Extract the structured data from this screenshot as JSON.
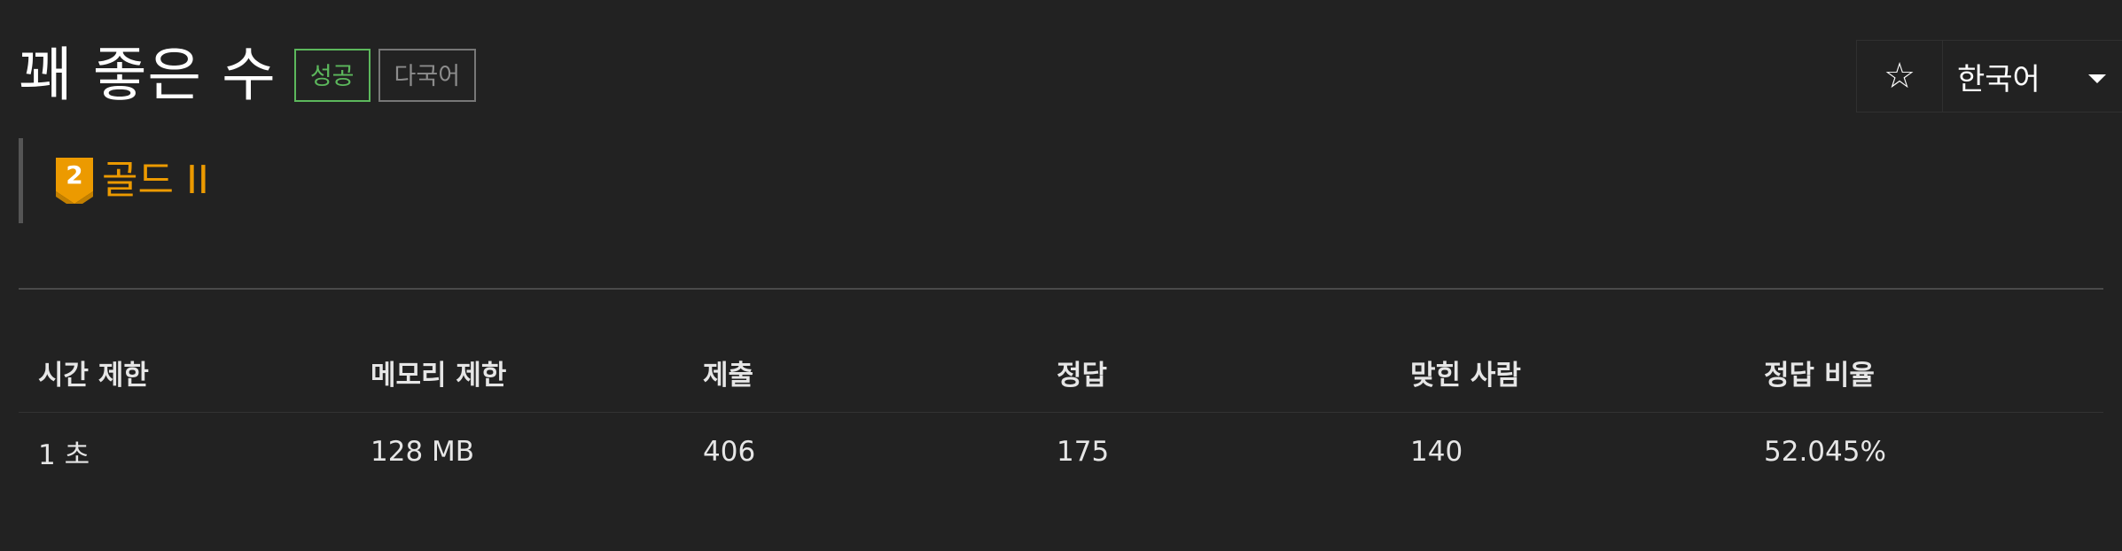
{
  "problem": {
    "title": "꽤 좋은 수",
    "labels": {
      "result": "성공",
      "language": "다국어"
    },
    "tier": {
      "number": "2",
      "name": "골드 II",
      "color": "#ec9a00"
    }
  },
  "toolbar": {
    "star_icon": "star-icon",
    "star_glyph": "☆",
    "language_selected": "한국어"
  },
  "info_table": {
    "headers": [
      "시간 제한",
      "메모리 제한",
      "제출",
      "정답",
      "맞힌 사람",
      "정답 비율"
    ],
    "row": [
      "1 초",
      "128 MB",
      "406",
      "175",
      "140",
      "52.045%"
    ]
  },
  "colors": {
    "background": "#222222",
    "success": "#5cb85c",
    "gold": "#ec9a00"
  }
}
